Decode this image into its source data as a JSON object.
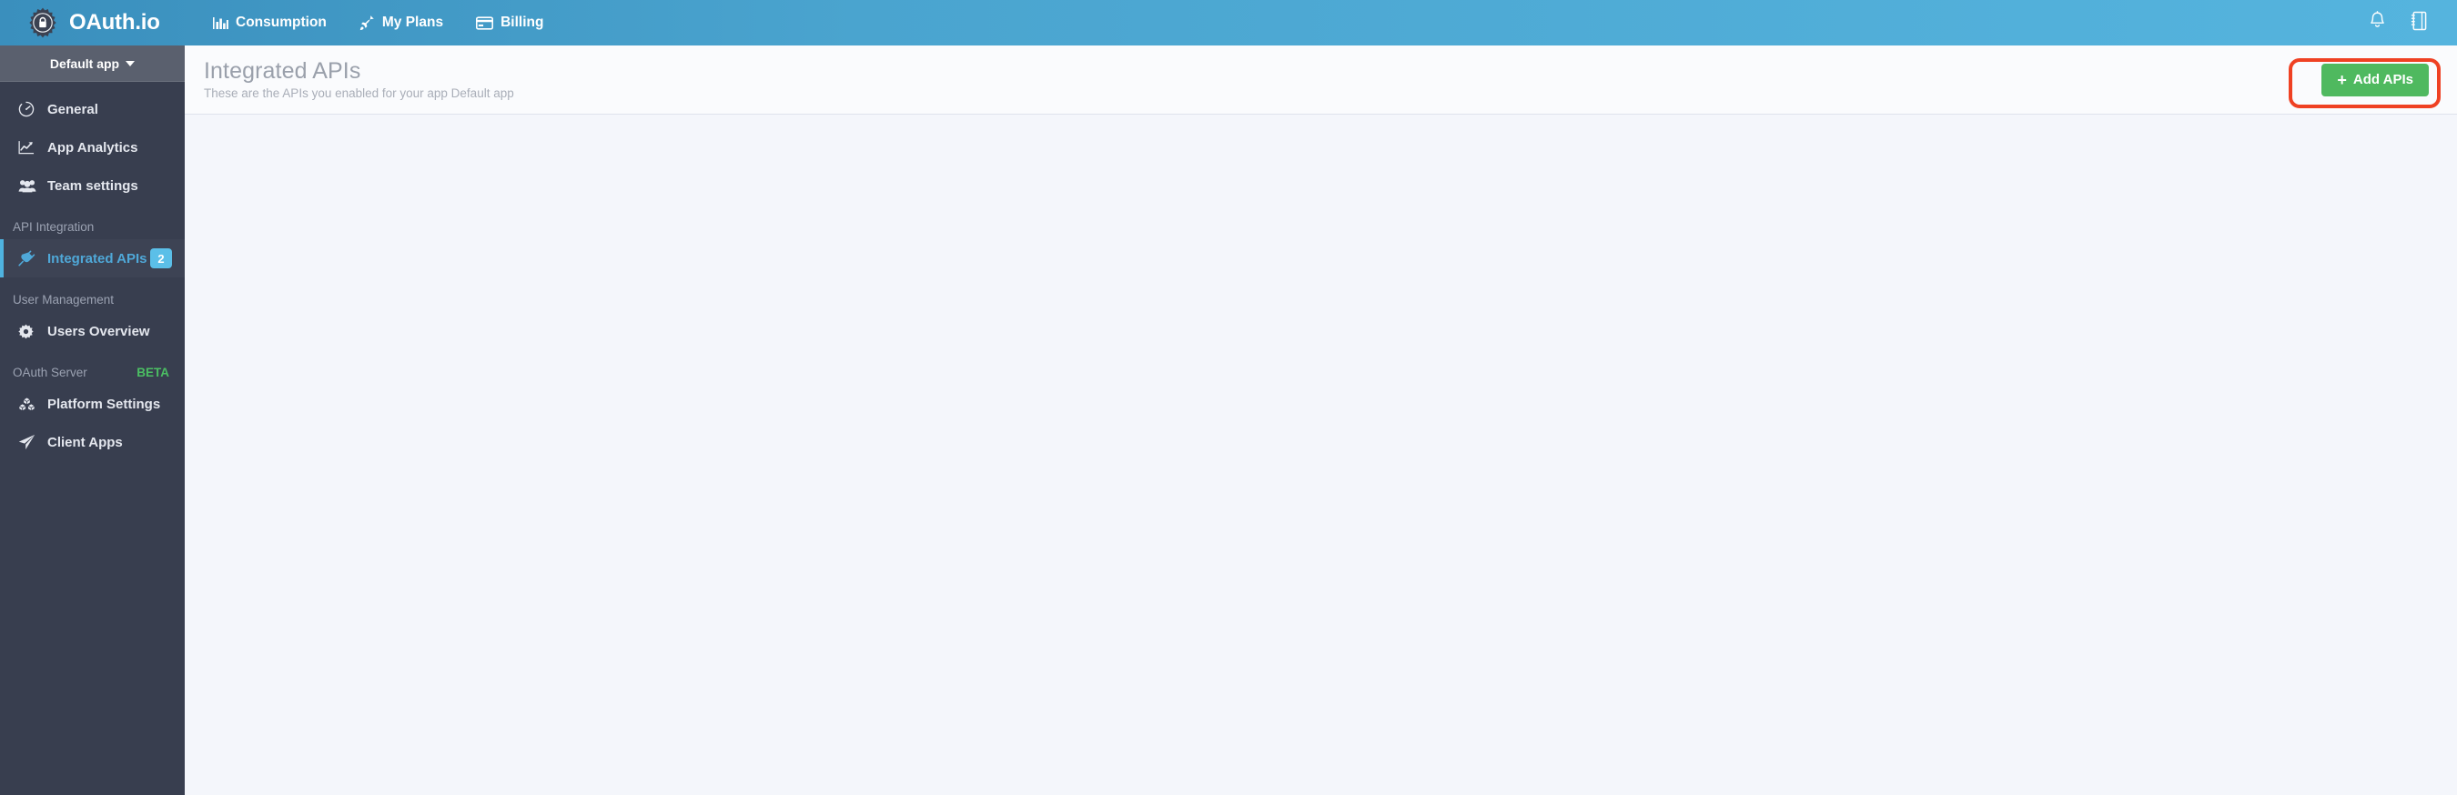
{
  "brand": {
    "name": "OAuth.io",
    "logo_icon": "gear-padlock-icon"
  },
  "topnav": {
    "items": [
      {
        "label": "Consumption",
        "icon": "bar-chart-icon"
      },
      {
        "label": "My Plans",
        "icon": "rocket-icon"
      },
      {
        "label": "Billing",
        "icon": "credit-card-icon"
      }
    ],
    "right_icons": [
      {
        "name": "bell-icon"
      },
      {
        "name": "notebook-icon"
      }
    ]
  },
  "sidebar": {
    "app_switcher": {
      "label": "Default app",
      "caret": "chevron-down-icon"
    },
    "groups": [
      {
        "section": null,
        "items": [
          {
            "label": "General",
            "icon": "gauge-icon",
            "active": false,
            "badge": null
          },
          {
            "label": "App Analytics",
            "icon": "line-chart-icon",
            "active": false,
            "badge": null
          },
          {
            "label": "Team settings",
            "icon": "users-group-icon",
            "active": false,
            "badge": null
          }
        ]
      },
      {
        "section": "API Integration",
        "section_tag": null,
        "items": [
          {
            "label": "Integrated APIs",
            "icon": "plug-icon",
            "active": true,
            "badge": "2"
          }
        ]
      },
      {
        "section": "User Management",
        "section_tag": null,
        "items": [
          {
            "label": "Users Overview",
            "icon": "gear-icon",
            "active": false,
            "badge": null
          }
        ]
      },
      {
        "section": "OAuth Server",
        "section_tag": "BETA",
        "items": [
          {
            "label": "Platform Settings",
            "icon": "cubes-icon",
            "active": false,
            "badge": null
          },
          {
            "label": "Client Apps",
            "icon": "paper-plane-icon",
            "active": false,
            "badge": null
          }
        ]
      }
    ]
  },
  "page": {
    "title": "Integrated APIs",
    "subtitle": "These are the APIs you enabled for your app Default app",
    "add_button": {
      "label": "Add APIs",
      "plus": "+",
      "icon": "plus-icon"
    }
  },
  "colors": {
    "topbar_start": "#3a8fbd",
    "topbar_end": "#55b4de",
    "sidebar": "#383e4f",
    "app_switcher": "#5a606e",
    "accent_blue": "#4fb3e0",
    "active_text": "#4fa8d8",
    "badge_blue": "#5bbfe8",
    "beta_green": "#4bbf63",
    "add_button_green": "#4fb95f",
    "highlight_red": "#ef4123",
    "content_bg": "#f4f6fb",
    "header_bg": "#fafbfd"
  }
}
